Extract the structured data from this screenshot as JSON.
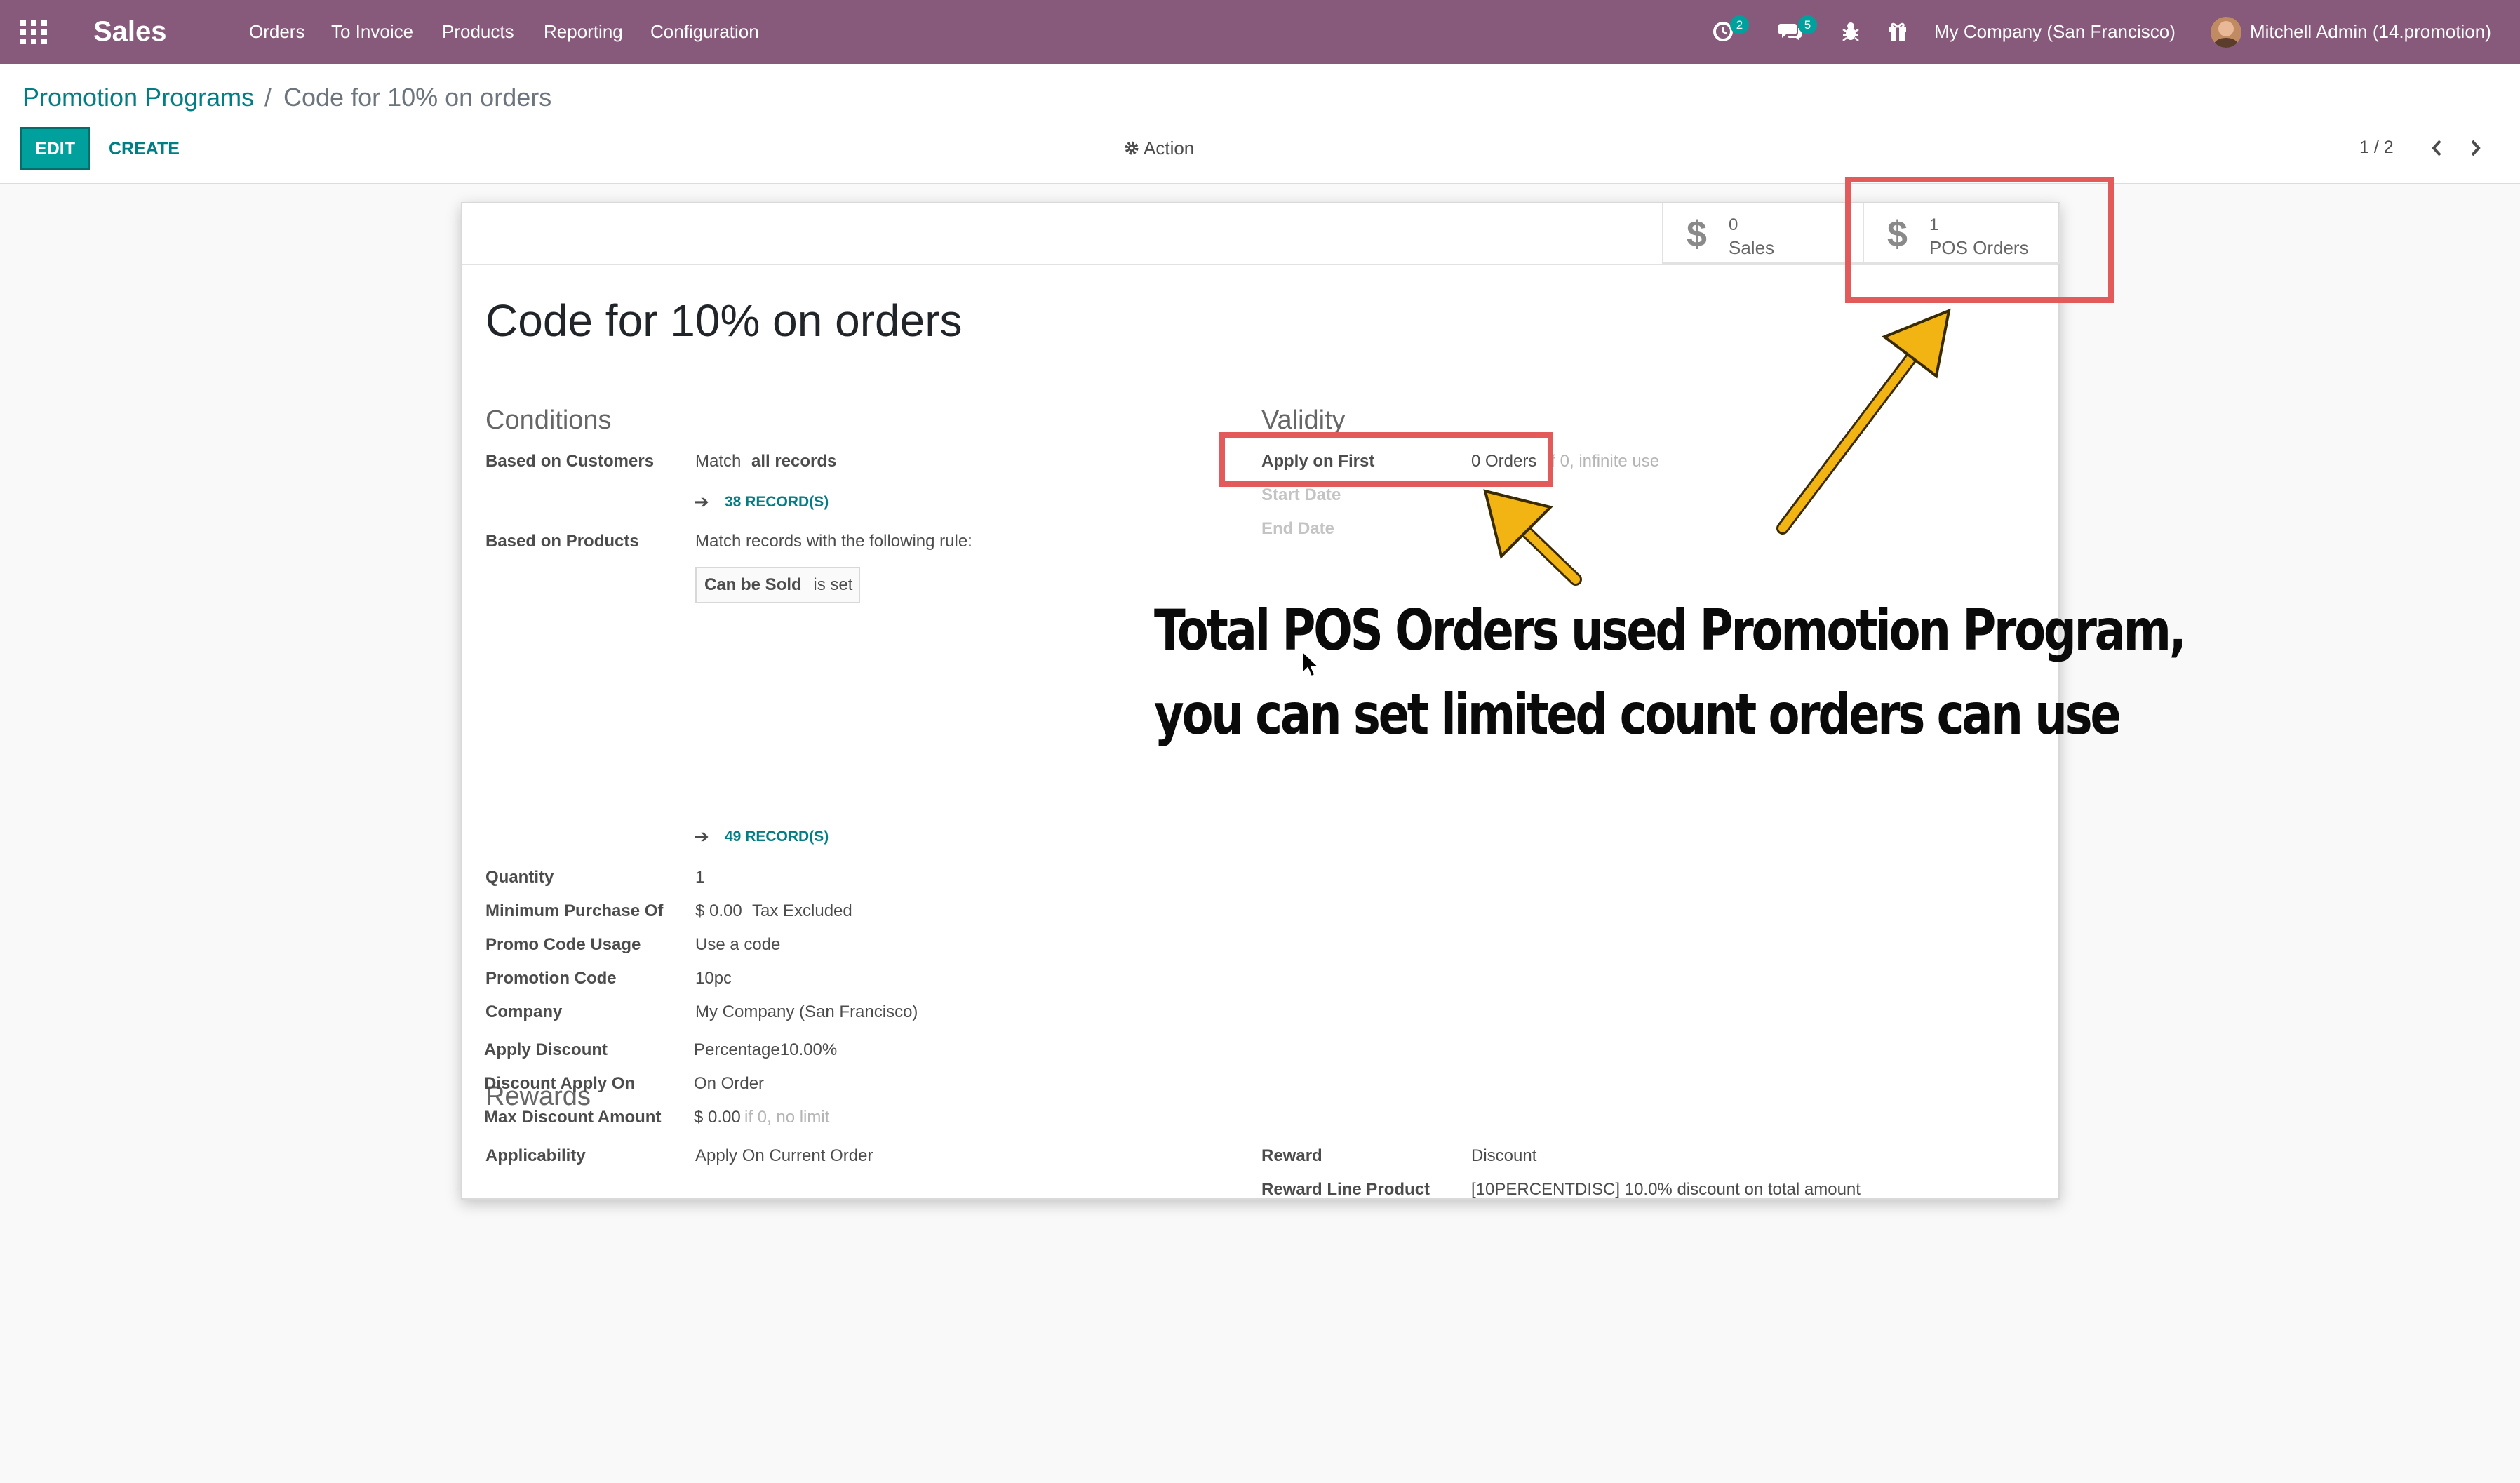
{
  "navbar": {
    "app_name": "Sales",
    "menu": [
      "Orders",
      "To Invoice",
      "Products",
      "Reporting",
      "Configuration"
    ],
    "activity_count": "2",
    "messages_count": "5",
    "company": "My Company (San Francisco)",
    "user": "Mitchell Admin (14.promotion)",
    "icons": [
      "apps-grid-icon",
      "activity-clock-icon",
      "chat-icon",
      "bug-icon",
      "gift-icon",
      "avatar"
    ],
    "color": "#875a7b"
  },
  "breadcrumb": {
    "parent": "Promotion Programs",
    "separator": "/",
    "current": "Code for 10% on orders"
  },
  "toolbar": {
    "edit": "EDIT",
    "create": "CREATE",
    "action": "Action",
    "pager": "1 / 2"
  },
  "smart_buttons": {
    "sales_count": "0",
    "sales_label": "Sales",
    "pos_count": "1",
    "pos_label": "POS Orders"
  },
  "form": {
    "title": "Code for 10% on orders",
    "conditions": {
      "heading": "Conditions",
      "customers_label": "Based on Customers",
      "customers_match": "Match",
      "customers_all": "all records",
      "customers_records": "38 RECORD(S)",
      "products_label": "Based on Products",
      "products_match": "Match records with the following rule:",
      "rule_field": "Can be Sold",
      "rule_op": "is set",
      "products_records": "49 RECORD(S)",
      "quantity_label": "Quantity",
      "quantity": "1",
      "min_purchase_label": "Minimum Purchase Of",
      "min_purchase": "$ 0.00",
      "min_purchase_tax": "Tax Excluded",
      "promo_usage_label": "Promo Code Usage",
      "promo_usage": "Use a code",
      "promo_code_label": "Promotion Code",
      "promo_code": "10pc",
      "company_label": "Company",
      "company": "My Company (San Francisco)"
    },
    "validity": {
      "heading": "Validity",
      "apply_first_label": "Apply on First",
      "apply_first": "0 Orders",
      "apply_first_hint": "if 0, infinite use",
      "start_date_label": "Start Date",
      "end_date_label": "End Date"
    },
    "rewards": {
      "heading": "Rewards",
      "applicability_label": "Applicability",
      "applicability": "Apply On Current Order",
      "reward_label": "Reward",
      "reward": "Discount",
      "reward_product_label": "Reward Line Product",
      "reward_product": "[10PERCENTDISC] 10.0% discount on total amount",
      "apply_discount_label": "Apply Discount",
      "apply_discount": "Percentage10.00%",
      "discount_on_label": "Discount Apply On",
      "discount_on": "On Order",
      "max_discount_label": "Max Discount Amount",
      "max_discount": "$ 0.00",
      "max_discount_hint": "if 0, no limit"
    }
  },
  "annotation": {
    "line1": "Total POS Orders used Promotion Program,",
    "line2": "you can set limited count orders can use",
    "highlight_color": "#e25a5a",
    "arrow_color": "#f1b412"
  }
}
